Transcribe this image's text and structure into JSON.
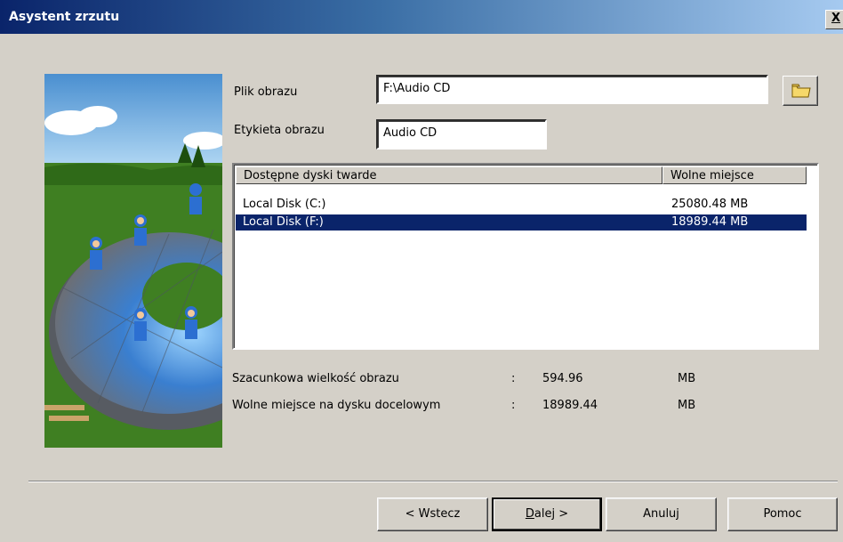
{
  "window": {
    "title": "Asystent zrzutu",
    "close_label": "X"
  },
  "form": {
    "image_file_label": "Plik obrazu",
    "image_file_value": "F:\\Audio CD",
    "image_label_label": "Etykieta obrazu",
    "image_label_value": "Audio CD"
  },
  "disks": {
    "columns": [
      "Dostępne dyski twarde",
      "Wolne miejsce"
    ],
    "rows": [
      {
        "name": "Local Disk (C:)",
        "free": "25080.48 MB",
        "selected": false
      },
      {
        "name": "Local Disk (F:)",
        "free": "18989.44 MB",
        "selected": true
      }
    ]
  },
  "info": {
    "estimated_size_label": "Szacunkowa wielkość obrazu",
    "estimated_size_sep": ":",
    "estimated_size_value": "594.96",
    "estimated_size_unit": "MB",
    "free_space_label": "Wolne miejsce na dysku docelowym",
    "free_space_sep": ":",
    "free_space_value": "18989.44",
    "free_space_unit": "MB"
  },
  "buttons": {
    "back_label": "< Wstecz",
    "next_mnemonic": "D",
    "next_rest": "alej >",
    "cancel_label": "Anuluj",
    "help_label": "Pomoc"
  },
  "icons": {
    "browse": "folder-icon",
    "illustration": "wizard-illustration"
  },
  "colors": {
    "title_gradient_start": "#0a246a",
    "selection": "#0a246a",
    "dialog_bg": "#d4d0c8"
  }
}
